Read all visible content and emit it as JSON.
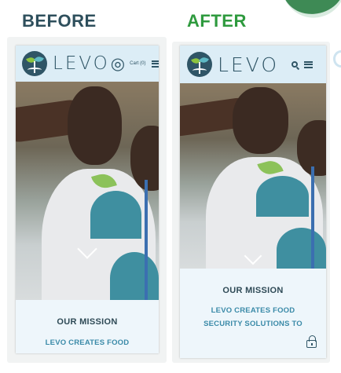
{
  "labels": {
    "before": "BEFORE",
    "after": "AFTER"
  },
  "colors": {
    "before_label": "#2e4f5c",
    "after_label": "#2e9a3e",
    "header_bg": "#dcedf6",
    "brand": "#2f5566",
    "subheading": "#3a8aa8"
  },
  "before": {
    "logo_text": "LEVO",
    "cart_icon": "cart-icon",
    "cart_label": "Cart (0)",
    "menu_icon": "hamburger-icon",
    "mission_title": "OUR MISSION",
    "mission_lines": [
      "LEVO CREATES FOOD"
    ]
  },
  "after": {
    "logo_text": "LEVO",
    "search_icon": "search-icon",
    "menu_icon": "hamburger-icon",
    "mission_title": "OUR MISSION",
    "mission_lines": [
      "LEVO CREATES FOOD",
      "SECURITY SOLUTIONS TO"
    ],
    "lock_icon": "lock-icon"
  }
}
